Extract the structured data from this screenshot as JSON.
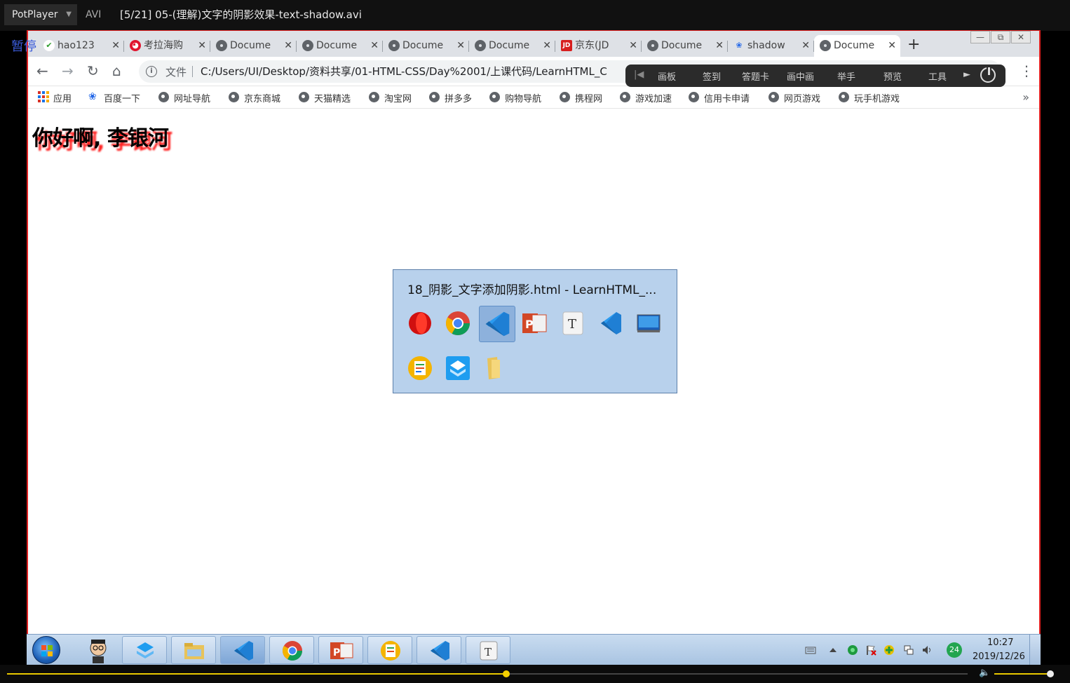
{
  "player": {
    "brand": "PotPlayer",
    "format": "AVI",
    "title": "[5/21] 05-(理解)文字的阴影效果-text-shadow.avi",
    "status": "暂停",
    "seek_fraction": 0.52,
    "volume_fraction": 0.95,
    "colors": {
      "accent": "#e8c800"
    }
  },
  "browser": {
    "tabs": [
      {
        "label": "hao123",
        "icon": "hao123-icon"
      },
      {
        "label": "考拉海购",
        "icon": "kaola-icon"
      },
      {
        "label": "Document",
        "icon": "globe-icon"
      },
      {
        "label": "Document",
        "icon": "globe-icon"
      },
      {
        "label": "Document",
        "icon": "globe-icon"
      },
      {
        "label": "Document",
        "icon": "globe-icon"
      },
      {
        "label": "京东(JD",
        "icon": "jd-icon"
      },
      {
        "label": "Document",
        "icon": "globe-icon"
      },
      {
        "label": "shadow",
        "icon": "baidu-paw-icon"
      },
      {
        "label": "Document",
        "icon": "globe-icon",
        "active": true
      }
    ],
    "toolbar": {
      "scheme_label": "文件",
      "url": "C:/Users/UI/Desktop/资料共享/01-HTML-CSS/Day%2001/上课代码/LearnHTML_C"
    },
    "bookmarks": [
      {
        "label": "应用",
        "icon": "apps-grid-icon"
      },
      {
        "label": "百度一下",
        "icon": "baidu-paw-icon"
      },
      {
        "label": "网址导航",
        "icon": "globe-icon"
      },
      {
        "label": "京东商城",
        "icon": "globe-icon"
      },
      {
        "label": "天猫精选",
        "icon": "globe-icon"
      },
      {
        "label": "淘宝网",
        "icon": "globe-icon"
      },
      {
        "label": "拼多多",
        "icon": "globe-icon"
      },
      {
        "label": "购物导航",
        "icon": "globe-icon"
      },
      {
        "label": "携程网",
        "icon": "globe-icon"
      },
      {
        "label": "游戏加速",
        "icon": "globe-icon"
      },
      {
        "label": "信用卡申请",
        "icon": "globe-icon"
      },
      {
        "label": "网页游戏",
        "icon": "globe-icon"
      },
      {
        "label": "玩手机游戏",
        "icon": "globe-icon"
      }
    ],
    "bookmarks_more": "»"
  },
  "teach_bar": {
    "items": [
      "画板",
      "签到",
      "答题卡",
      "画中画",
      "举手",
      "预览",
      "工具"
    ]
  },
  "page": {
    "heading": "你好啊, 李银河",
    "colors": {
      "text": "#000000",
      "shadow": "#ff2020"
    }
  },
  "switcher": {
    "title": "18_阴影_文字添加阴影.html - LearnHTML_..."
  },
  "taskbar": {
    "tray_badge": "24",
    "time": "10:27",
    "date": "2019/12/26"
  }
}
